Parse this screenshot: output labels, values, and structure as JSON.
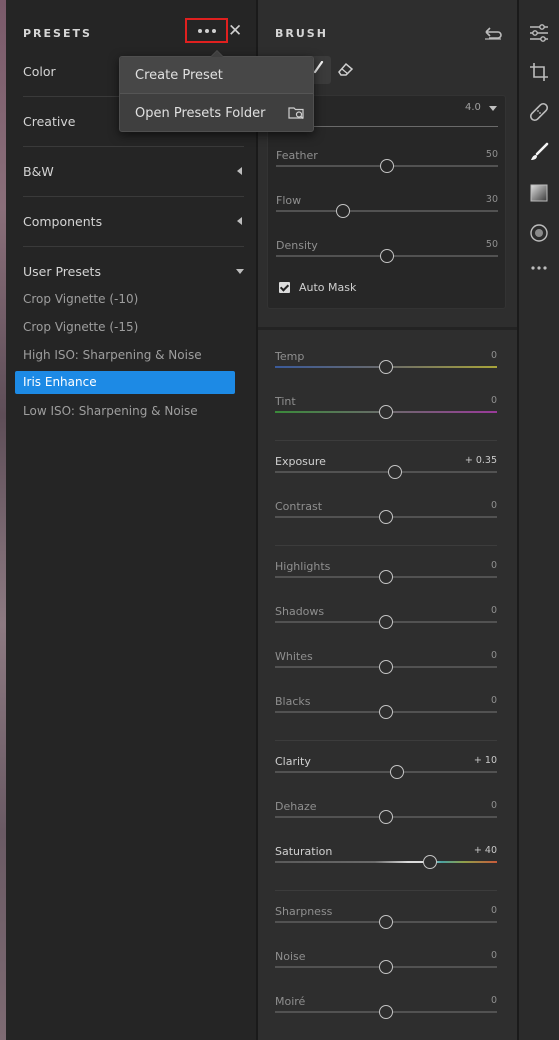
{
  "presets_panel": {
    "title": "PRESETS",
    "categories": [
      {
        "label": "Color"
      },
      {
        "label": "Creative"
      },
      {
        "label": "B&W"
      },
      {
        "label": "Components"
      },
      {
        "label": "User Presets"
      }
    ],
    "user_presets": [
      {
        "label": "Crop Vignette (-10)",
        "selected": false
      },
      {
        "label": "Crop Vignette (-15)",
        "selected": false
      },
      {
        "label": "High ISO:  Sharpening & Noise",
        "selected": false
      },
      {
        "label": "Iris Enhance",
        "selected": true
      },
      {
        "label": "Low ISO: Sharpening & Noise",
        "selected": false
      }
    ]
  },
  "menu": {
    "create_preset": "Create Preset",
    "open_presets_folder": "Open Presets Folder"
  },
  "brush_panel": {
    "title": "BRUSH",
    "size_value": "4.0",
    "brush_sliders": [
      {
        "label": "Feather",
        "value": "50",
        "position": 0.5
      },
      {
        "label": "Flow",
        "value": "30",
        "position": 0.3
      },
      {
        "label": "Density",
        "value": "50",
        "position": 0.5
      }
    ],
    "auto_mask": {
      "label": "Auto Mask",
      "checked": true
    },
    "adjustments": [
      {
        "label": "Temp",
        "value": "0",
        "position": 0.5,
        "bright": false,
        "gradient": "temp"
      },
      {
        "label": "Tint",
        "value": "0",
        "position": 0.5,
        "bright": false,
        "gradient": "tint"
      },
      {
        "label": "Exposure",
        "value": "+ 0.35",
        "position": 0.54,
        "bright": true
      },
      {
        "label": "Contrast",
        "value": "0",
        "position": 0.5,
        "bright": false
      },
      {
        "label": "Highlights",
        "value": "0",
        "position": 0.5,
        "bright": false
      },
      {
        "label": "Shadows",
        "value": "0",
        "position": 0.5,
        "bright": false
      },
      {
        "label": "Whites",
        "value": "0",
        "position": 0.5,
        "bright": false
      },
      {
        "label": "Blacks",
        "value": "0",
        "position": 0.5,
        "bright": false
      },
      {
        "label": "Clarity",
        "value": "+ 10",
        "position": 0.55,
        "bright": true
      },
      {
        "label": "Dehaze",
        "value": "0",
        "position": 0.5,
        "bright": false
      },
      {
        "label": "Saturation",
        "value": "+ 40",
        "position": 0.7,
        "bright": true,
        "gradient": "saturation"
      },
      {
        "label": "Sharpness",
        "value": "0",
        "position": 0.5,
        "bright": false
      },
      {
        "label": "Noise",
        "value": "0",
        "position": 0.5,
        "bright": false
      },
      {
        "label": "Moiré",
        "value": "0",
        "position": 0.5,
        "bright": false
      }
    ]
  },
  "toolbar": {
    "tools": [
      "sliders-icon",
      "crop-icon",
      "healing-icon",
      "brush-icon",
      "gradient-icon",
      "radial-icon",
      "more-icon"
    ]
  },
  "colors": {
    "selection": "#1d8ae5",
    "highlight_box": "#e0201f"
  }
}
